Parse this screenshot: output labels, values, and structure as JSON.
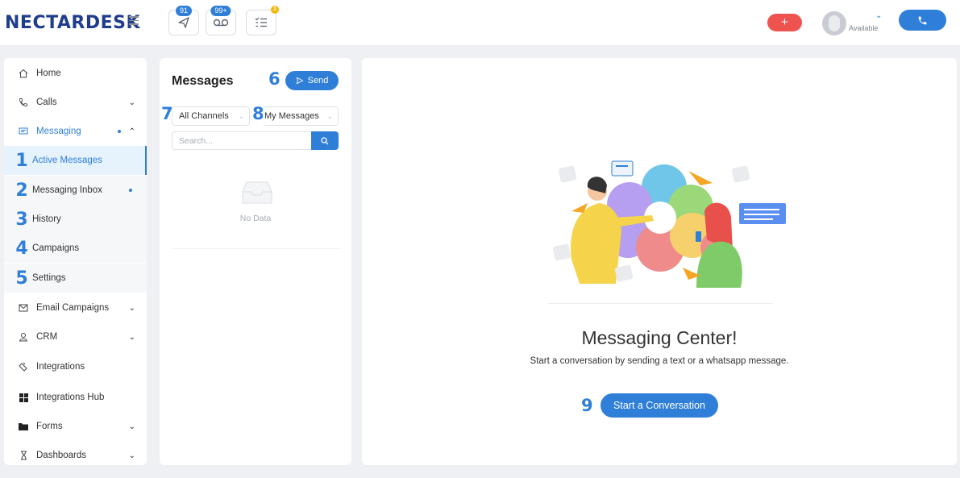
{
  "app": {
    "logo_part1": "NECTARDESK",
    "colors": {
      "accent": "#2f7fd8",
      "danger": "#ef5350",
      "logo_blue": "#1f3d8c",
      "logo_yellow": "#f5c518"
    }
  },
  "topbar": {
    "icons": [
      {
        "name": "send-icon",
        "badge": "91"
      },
      {
        "name": "voicemail-icon",
        "badge": "99+"
      },
      {
        "name": "tasks-icon",
        "badge": "1"
      }
    ],
    "plus_label": "+",
    "status": "Available"
  },
  "sidebar": {
    "items": [
      {
        "label": "Home",
        "icon": "home-icon"
      },
      {
        "label": "Calls",
        "icon": "phone-icon",
        "chevron": "down"
      },
      {
        "label": "Messaging",
        "icon": "message-icon",
        "chevron": "up"
      }
    ],
    "subitems": [
      {
        "num": "1",
        "label": "Active Messages"
      },
      {
        "num": "2",
        "label": "Messaging Inbox"
      },
      {
        "num": "3",
        "label": "History"
      },
      {
        "num": "4",
        "label": "Campaigns"
      },
      {
        "num": "5",
        "label": "Settings"
      }
    ],
    "items_after": [
      {
        "label": "Email Campaigns",
        "icon": "envelope-icon",
        "chevron": "down"
      },
      {
        "label": "CRM",
        "icon": "user-icon",
        "chevron": "down"
      },
      {
        "label": "Integrations",
        "icon": "plug-icon"
      },
      {
        "label": "Integrations Hub",
        "icon": "grid-icon"
      },
      {
        "label": "Forms",
        "icon": "folder-icon",
        "chevron": "down"
      },
      {
        "label": "Dashboards",
        "icon": "hourglass-icon",
        "chevron": "down"
      }
    ]
  },
  "messages_panel": {
    "title": "Messages",
    "send_num": "6",
    "send_label": "Send",
    "channel_num": "7",
    "channel_value": "All Channels",
    "filter_num": "8",
    "filter_value": "My Messages",
    "search_placeholder": "Search...",
    "empty_text": "No Data"
  },
  "main": {
    "headline": "Messaging Center!",
    "subline": "Start a conversation by sending a text or a whatsapp message.",
    "start_num": "9",
    "start_label": "Start a Conversation"
  }
}
